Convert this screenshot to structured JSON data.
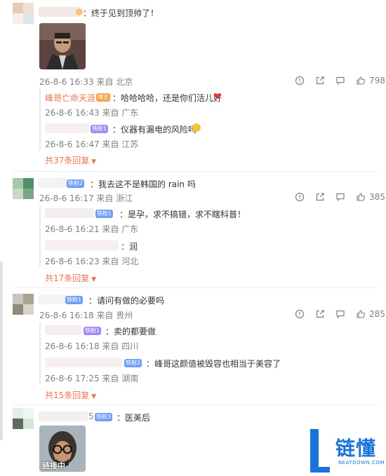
{
  "comments": [
    {
      "text": "：终于见到顶帅了！",
      "image_caption": "",
      "time_loc": "26-8-6 16:33 来自 北京",
      "likes": "798",
      "replies": [
        {
          "name": "峰哥亡命天涯",
          "badge": "博主",
          "text": "：哈哈哈哈，还是你们活儿好",
          "time_loc": "26-8-6 16:43 来自 广东"
        },
        {
          "name": "",
          "badge": "铁粉1",
          "text": "：仪器有漏电的风险吗",
          "time_loc": "26-8-6 16:47 来自 江苏"
        }
      ],
      "more": "共37条回复"
    },
    {
      "text": "：我去这不是韩国的 rain 吗",
      "badge": "铁粉2",
      "time_loc": "26-8-6 16:17 来自 浙江",
      "likes": "385",
      "replies": [
        {
          "badge": "铁粉1",
          "text": "：是孕，求不搞错，求不瞎科普！",
          "time_loc": "26-8-6 16:21 来自 广东"
        },
        {
          "text": "：润",
          "time_loc": "26-8-6 16:23 来自 河北"
        }
      ],
      "more": "共17条回复"
    },
    {
      "text": "：请问有做的必要吗",
      "badge": "铁粉1",
      "time_loc": "26-8-6 16:18 来自 贵州",
      "likes": "285",
      "replies": [
        {
          "badge": "铁粉1",
          "text": "：卖的都要做",
          "time_loc": "26-8-6 16:18 来自 四川"
        },
        {
          "badge": "铁粉2",
          "text": "：峰哥这颜值被毁容也相当于美容了",
          "time_loc": "26-8-6 17:25 来自 湖南"
        }
      ],
      "more": "共15条回复"
    },
    {
      "text": "：医美后",
      "name_suffix": "5",
      "badge": "铁粉3",
      "image_caption": "链接中"
    }
  ],
  "watermark": {
    "brand": "链懂",
    "site": "NEATDOWN.COM",
    "letter": "L"
  },
  "colors": {
    "accent": "#eb7350",
    "meta": "#808080",
    "badge_blue": "#6f9ef5",
    "badge_purple": "#a48af0",
    "badge_orange": "#f5a04a",
    "brand_blue": "#1a73d9"
  },
  "icons": [
    "report-icon",
    "share-icon",
    "comment-icon",
    "like-icon",
    "heart-icon",
    "chevron-down-icon"
  ]
}
